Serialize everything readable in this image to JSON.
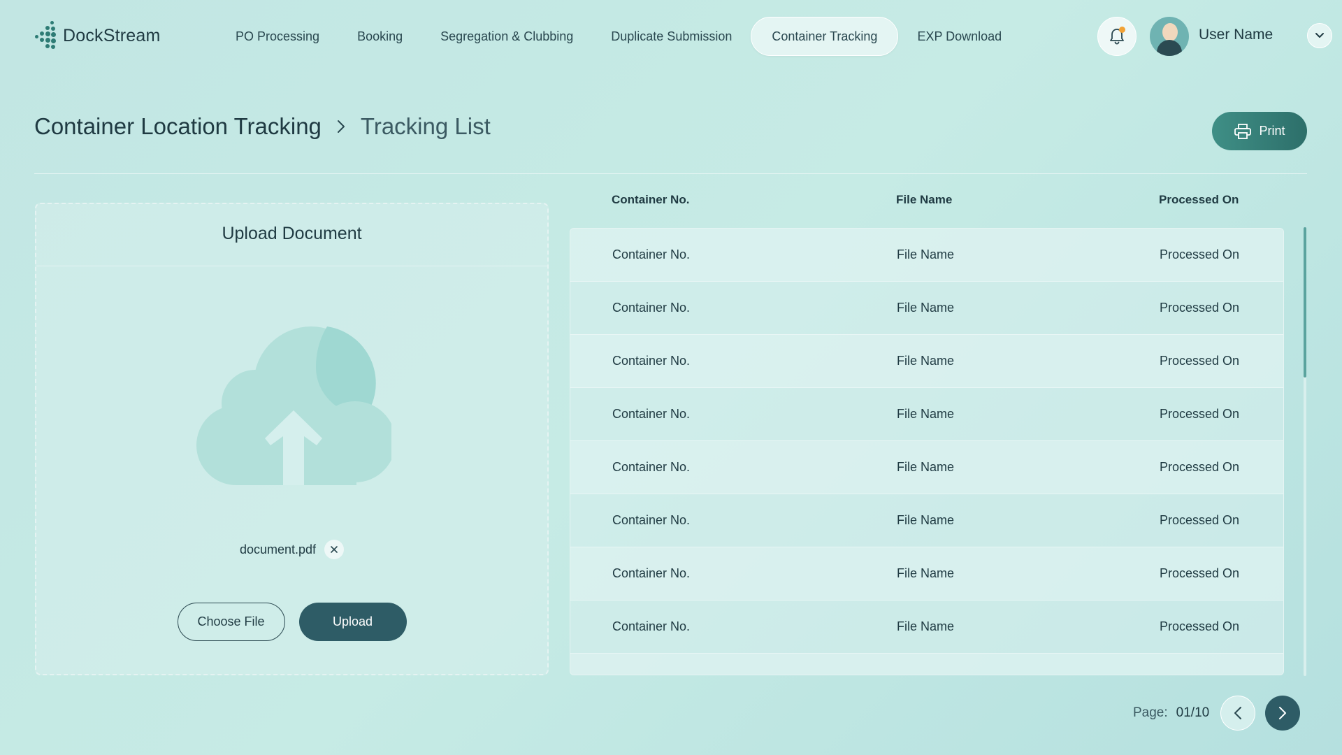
{
  "app": {
    "name": "DockStream",
    "logo_icon": "dots-logo-icon"
  },
  "nav": {
    "items": [
      {
        "label": "PO Processing",
        "active": false
      },
      {
        "label": "Booking",
        "active": false
      },
      {
        "label": "Segregation & Clubbing",
        "active": false
      },
      {
        "label": "Duplicate Submission",
        "active": false
      },
      {
        "label": "Container Tracking",
        "active": true
      },
      {
        "label": "EXP Download",
        "active": false
      }
    ]
  },
  "user": {
    "name": "User Name",
    "has_notification": true
  },
  "header": {
    "title": "Container Location Tracking",
    "breadcrumb_current": "Tracking List",
    "print_label": "Print"
  },
  "upload": {
    "title": "Upload Document",
    "file_name": "document.pdf",
    "choose_label": "Choose File",
    "upload_label": "Upload"
  },
  "table": {
    "columns": [
      "Container No.",
      "File Name",
      "Processed On"
    ],
    "rows": [
      [
        "Container No.",
        "File Name",
        "Processed On"
      ],
      [
        "Container No.",
        "File Name",
        "Processed On"
      ],
      [
        "Container No.",
        "File Name",
        "Processed On"
      ],
      [
        "Container No.",
        "File Name",
        "Processed On"
      ],
      [
        "Container No.",
        "File Name",
        "Processed On"
      ],
      [
        "Container No.",
        "File Name",
        "Processed On"
      ],
      [
        "Container No.",
        "File Name",
        "Processed On"
      ],
      [
        "Container No.",
        "File Name",
        "Processed On"
      ]
    ]
  },
  "pagination": {
    "label": "Page:",
    "value": "01/10"
  },
  "colors": {
    "accent": "#2e5c66",
    "brand": "#2e7c75",
    "notification": "#f2a235"
  }
}
